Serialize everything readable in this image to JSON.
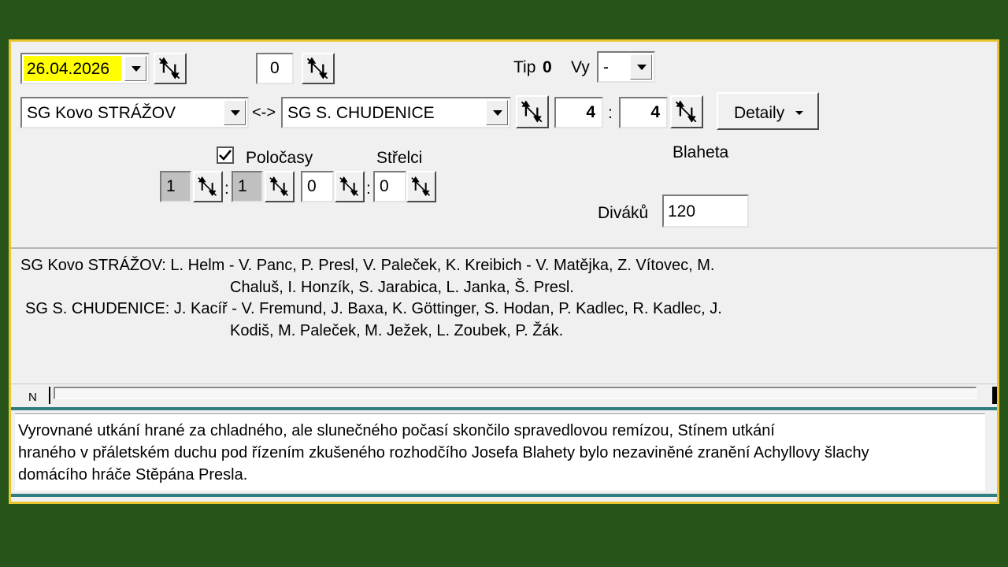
{
  "match": {
    "date": "26.04.2026",
    "round": "0",
    "tip_label": "Tip",
    "tip_value": "0",
    "vy_label": "Vy",
    "vy_value": "-",
    "home_team": "SG Kovo STRÁŽOV",
    "separator": "<->",
    "away_team": "SG S. CHUDENICE",
    "score_home": "4",
    "score_colon": ":",
    "score_away": "4",
    "details_label": "Detaily",
    "halftimes_label": "Poločasy",
    "halftimes_checked": true,
    "scorers_label": "Střelci",
    "referee": "Blaheta",
    "half_home": "1",
    "half_away": "1",
    "scorers_home": "0",
    "scorers_away": "0",
    "spectators_label": "Diváků",
    "spectators": "120"
  },
  "lineups": {
    "home_line1": "SG Kovo STRÁŽOV: L. Helm - V. Panc, P. Presl, V. Paleček, K. Kreibich - V. Matějka, Z. Vítovec, M.",
    "home_line2": "Chaluš, I. Honzík, S. Jarabica, L. Janka, Š. Presl.",
    "away_line1": "SG S. CHUDENICE: J. Kacíř - V. Fremund, J. Baxa, K. Göttinger, S. Hodan, P. Kadlec, R. Kadlec, J.",
    "away_line2": "Kodiš, M. Paleček, M. Ježek, L. Zoubek, P. Žák."
  },
  "toolbar": {
    "n_label": "N"
  },
  "report": {
    "line1": "Vyrovnané utkání  hrané za chladného, ale slunečného počasí skončilo spravedlovou remízou, Stínem utkání",
    "line2": "hraného v přáletském duchu  pod řízením zkušeného rozhodčího Josefa Blahety bylo nezaviněné zranění Achyllovy šlachy",
    "line3": "domácího hráče Stěpána  Presla."
  },
  "colors": {
    "background": "#265419",
    "frame_border": "#e9c52f",
    "panel": "#f0f0f0",
    "date_highlight": "#ffff00",
    "separator_teal": "#2f7f7f"
  }
}
